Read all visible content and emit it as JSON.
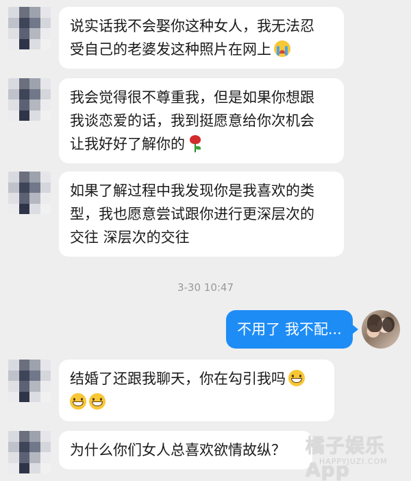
{
  "messages": [
    {
      "from": "contact",
      "lines": [
        "说实话我不会娶你这种女人，我无法忍",
        "受自己的老婆发这种照片在网上"
      ],
      "trailing_emoji": "crying-face-emoji"
    },
    {
      "from": "contact",
      "lines": [
        "我会觉得很不尊重我，但是如果你想跟",
        "我谈恋爱的话，我到挺愿意给你次机会",
        "让我好好了解你的"
      ],
      "trailing_emoji": "rose-emoji"
    },
    {
      "from": "contact",
      "lines": [
        "如果了解过程中我发现你是我喜欢的类",
        "型，我也愿意尝试跟你进行更深层次的",
        "交往 深层次的交往"
      ]
    },
    {
      "from": "contact",
      "lines": [
        "结婚了还跟我聊天，你在勾引我吗"
      ],
      "trailing_emoji": "grinning-face-emoji",
      "second_line_emoji_count": 2
    },
    {
      "from": "contact",
      "lines": [
        "为什么你们女人总喜欢欲情故纵？"
      ]
    }
  ],
  "timestamp": "3-30 10:47",
  "sent_message": "不用了 我不配...",
  "watermark": {
    "title": "橘子娱乐App",
    "url": "HAPPYJUZI.COM"
  },
  "colors": {
    "background": "#eeeeee",
    "incoming_bubble": "#ffffff",
    "outgoing_bubble": "#1e8cf5",
    "timestamp_text": "#999999"
  }
}
